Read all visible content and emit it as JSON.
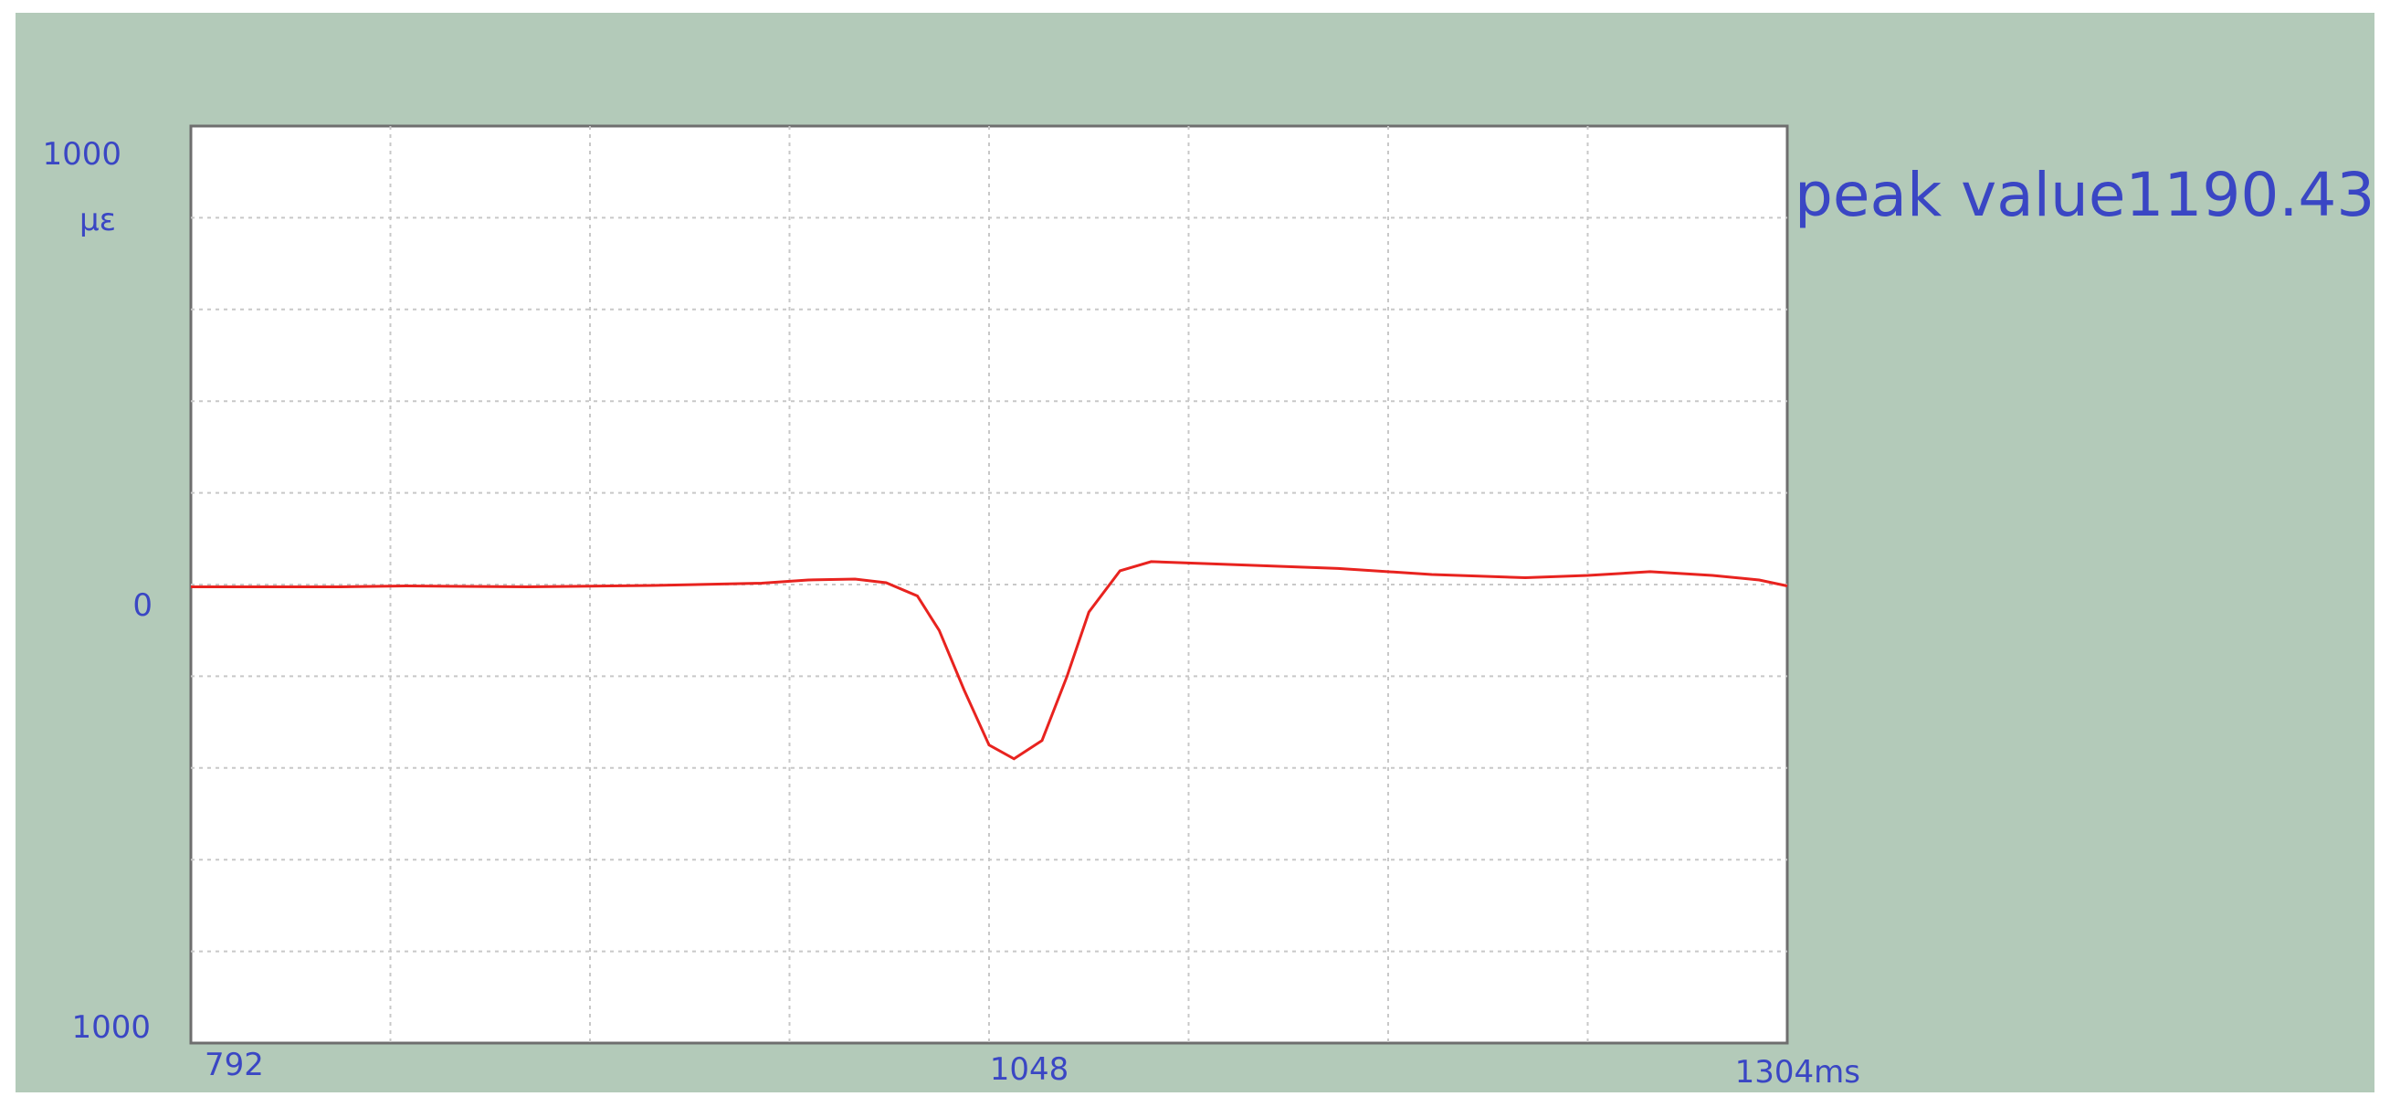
{
  "window": {
    "background": "#b3cab9"
  },
  "chart_data": {
    "type": "line",
    "title": "",
    "xlabel": "",
    "ylabel": "με",
    "y_tick_labels": {
      "top": "1000",
      "middle": "0",
      "bottom": "1000"
    },
    "x_tick_labels": {
      "start": "792",
      "middle": "1048",
      "end": "1304ms"
    },
    "xlim": [
      792,
      1304
    ],
    "ylim": [
      -1000,
      1000
    ],
    "grid": true,
    "line_color": "#e8231f",
    "axis_text_color": "#3a46c4",
    "annotation": "peak value1190.43",
    "series": [
      {
        "x": [
          792,
          840,
          861,
          900,
          940,
          975,
          990,
          1005,
          1015,
          1025,
          1032,
          1040,
          1048,
          1056,
          1065,
          1073,
          1080,
          1090,
          1100,
          1120,
          1140,
          1160,
          1190,
          1220,
          1240,
          1260,
          1280,
          1295,
          1304
        ],
        "y": [
          -5,
          -5,
          -3,
          -5,
          -2,
          3,
          10,
          12,
          4,
          -25,
          -100,
          -230,
          -350,
          -380,
          -340,
          -200,
          -60,
          30,
          50,
          45,
          40,
          35,
          22,
          15,
          20,
          28,
          20,
          10,
          -3
        ]
      }
    ]
  }
}
